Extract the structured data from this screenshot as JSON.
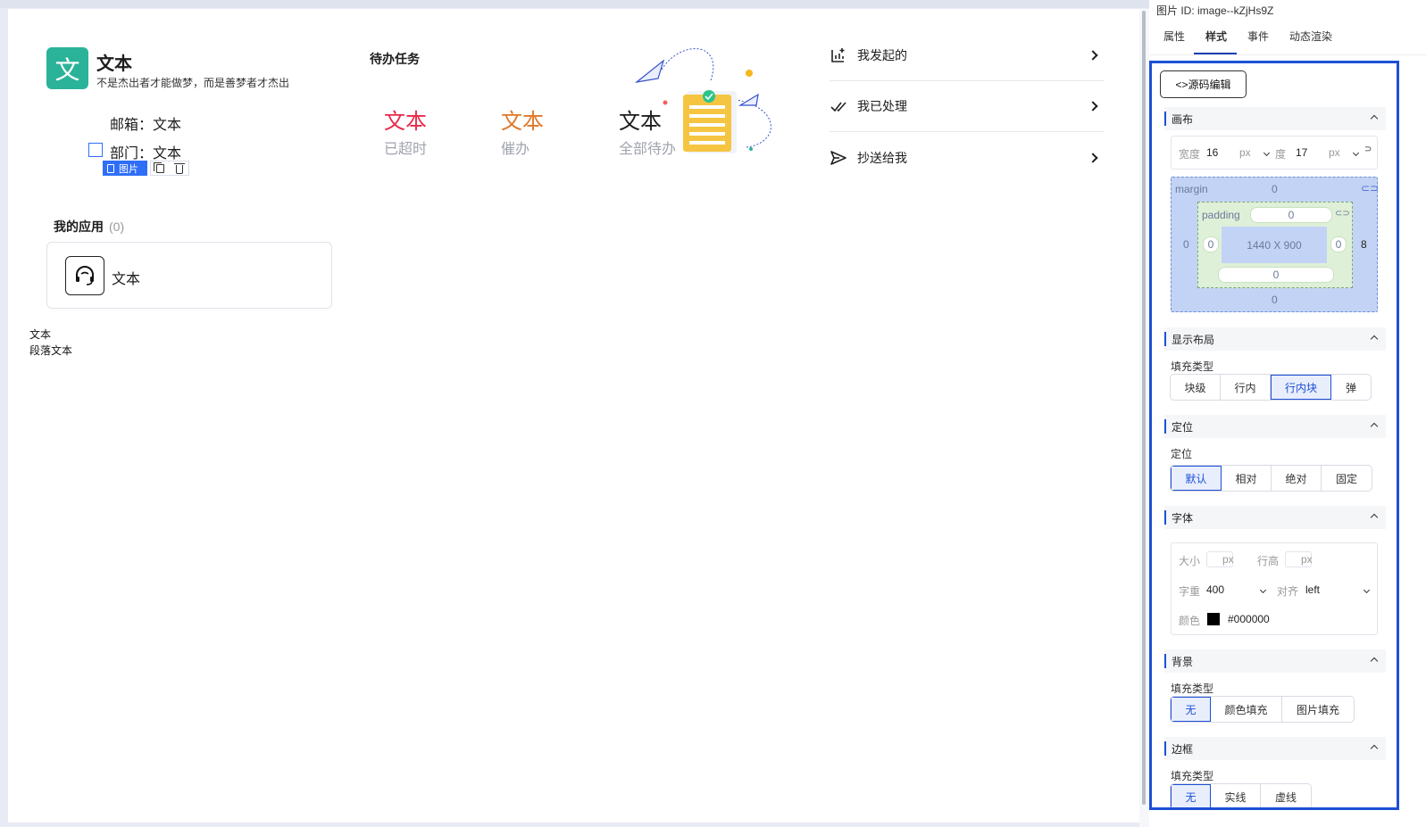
{
  "canvas": {
    "user": {
      "avatar_char": "文",
      "name": "文本",
      "motto": "不是杰出者才能做梦，而是善梦者才杰出",
      "email_label": "邮箱：",
      "email_value": "文本",
      "dept_label": "部门：",
      "dept_value": "文本"
    },
    "selection_chip": {
      "label": "图片",
      "tools": [
        "copy-icon",
        "trash-icon"
      ]
    },
    "todo": {
      "title": "待办任务",
      "stats": [
        {
          "value": "文本",
          "label": "已超时",
          "color": "#e8294a"
        },
        {
          "value": "文本",
          "label": "催办",
          "color": "#e0782a"
        },
        {
          "value": "文本",
          "label": "全部待办",
          "color": "#1d1d1f"
        }
      ]
    },
    "shortcuts": [
      {
        "label": "我发起的",
        "icon": "chart-plus-icon"
      },
      {
        "label": "我已处理",
        "icon": "double-check-icon"
      },
      {
        "label": "抄送给我",
        "icon": "send-icon"
      }
    ],
    "apps": {
      "title": "我的应用",
      "count": "(0)",
      "items": [
        {
          "name": "文本",
          "icon": "headset-icon"
        }
      ]
    },
    "plain_texts": [
      "文本",
      "段落文本"
    ]
  },
  "panel": {
    "image_id": "图片 ID:  image--kZjHs9Z",
    "tabs": [
      "属性",
      "样式",
      "事件",
      "动态渲染"
    ],
    "active_tab": "样式",
    "source_edit_label": "<>源码编辑",
    "sections": {
      "canvas": "画布",
      "layout": "显示布局",
      "position": "定位",
      "font": "字体",
      "background": "背景",
      "border": "边框"
    },
    "size": {
      "width_label": "宽度",
      "width_value": "16",
      "width_unit": "px",
      "height_label": "度",
      "height_value": "17",
      "height_unit": "px"
    },
    "box_model": {
      "margin_label": "margin",
      "margin_top": "0",
      "margin_left": "0",
      "margin_right": "8",
      "margin_bottom": "0",
      "padding_label": "padding",
      "padding_top": "0",
      "padding_left": "0",
      "padding_right": "0",
      "padding_bottom": "0",
      "content_size": "1440 X 900"
    },
    "layout": {
      "fill_type_label": "填充类型",
      "options": [
        "块级",
        "行内",
        "行内块",
        "弹"
      ],
      "selected": "行内块"
    },
    "position": {
      "label": "定位",
      "options": [
        "默认",
        "相对",
        "绝对",
        "固定"
      ],
      "selected": "默认"
    },
    "font": {
      "size_label": "大小",
      "size_unit": "px",
      "line_height_label": "行高",
      "line_height_unit": "px",
      "weight_label": "字重",
      "weight_value": "400",
      "align_label": "对齐",
      "align_value": "left",
      "color_label": "颜色",
      "color_value": "#000000"
    },
    "background": {
      "fill_type_label": "填充类型",
      "options": [
        "无",
        "颜色填充",
        "图片填充"
      ],
      "selected": "无"
    },
    "border": {
      "fill_type_label": "填充类型",
      "options": [
        "无",
        "实线",
        "虚线"
      ],
      "selected": "无"
    },
    "accent_color": "#1d4fd6"
  }
}
